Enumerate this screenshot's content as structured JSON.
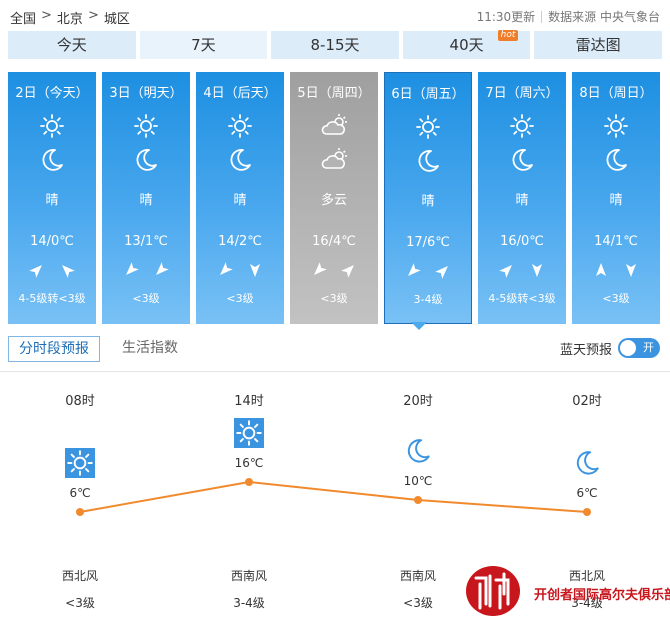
{
  "breadcrumb": {
    "level1": "全国",
    "level2": "北京",
    "level3": "城区",
    "separator": ">"
  },
  "meta": {
    "updated": "11:30更新",
    "source": "数据来源 中央气象台"
  },
  "tabs": [
    {
      "label": "今天"
    },
    {
      "label": "7天"
    },
    {
      "label": "8-15天"
    },
    {
      "label": "40天",
      "badge": "hot"
    },
    {
      "label": "雷达图"
    }
  ],
  "days": [
    {
      "title": "2日（今天）",
      "day_icon": "sun-icon",
      "night_icon": "moon-icon",
      "desc": "晴",
      "temp": "14/0℃",
      "wind_day": "arrow-northeast",
      "wind_night": "arrow-northwest",
      "level": "4-5级转<3级"
    },
    {
      "title": "3日（明天）",
      "day_icon": "sun-icon",
      "night_icon": "moon-icon",
      "desc": "晴",
      "temp": "13/1℃",
      "wind_day": "arrow-southwest",
      "wind_night": "arrow-southwest",
      "level": "<3级"
    },
    {
      "title": "4日（后天）",
      "day_icon": "sun-icon",
      "night_icon": "moon-icon",
      "desc": "晴",
      "temp": "14/2℃",
      "wind_day": "arrow-southwest",
      "wind_night": "arrow-south",
      "level": "<3级"
    },
    {
      "title": "5日（周四）",
      "day_icon": "partly-cloudy-icon",
      "night_icon": "partly-cloudy-icon",
      "desc": "多云",
      "temp": "16/4℃",
      "wind_day": "arrow-southwest",
      "wind_night": "arrow-northeast",
      "level": "<3级"
    },
    {
      "title": "6日（周五）",
      "day_icon": "sun-icon",
      "night_icon": "moon-icon",
      "desc": "晴",
      "temp": "17/6℃",
      "wind_day": "arrow-southwest",
      "wind_night": "arrow-northeast",
      "level": "3-4级"
    },
    {
      "title": "7日（周六）",
      "day_icon": "sun-icon",
      "night_icon": "moon-icon",
      "desc": "晴",
      "temp": "16/0℃",
      "wind_day": "arrow-northeast",
      "wind_night": "arrow-south",
      "level": "4-5级转<3级"
    },
    {
      "title": "8日（周日）",
      "day_icon": "sun-icon",
      "night_icon": "moon-icon",
      "desc": "晴",
      "temp": "14/1℃",
      "wind_day": "arrow-north",
      "wind_night": "arrow-south",
      "level": "<3级"
    }
  ],
  "subtabs": {
    "hourly": "分时段预报",
    "life": "生活指数"
  },
  "toggle": {
    "label": "蓝天预报",
    "state": "开"
  },
  "hourly": [
    {
      "time": "08时",
      "icon": "sun-icon",
      "temp": "6℃",
      "temp_value": 6,
      "wind": "西北风",
      "level": "<3级"
    },
    {
      "time": "14时",
      "icon": "sun-icon",
      "temp": "16℃",
      "temp_value": 16,
      "wind": "西南风",
      "level": "3-4级"
    },
    {
      "time": "20时",
      "icon": "moon-icon",
      "temp": "10℃",
      "temp_value": 10,
      "wind": "西南风",
      "level": "<3级"
    },
    {
      "time": "02时",
      "icon": "moon-icon",
      "temp": "6℃",
      "temp_value": 6,
      "wind": "西北风",
      "level": "3-4级"
    }
  ],
  "colors": {
    "line": "#f08a2c",
    "day_sunny_top": "#1d8fe1",
    "day_cloudy": "#a8a8a8",
    "icon_blue": "#3b94df",
    "watermark_red": "#c8161d"
  },
  "watermark": {
    "text": "开创者国际高尔夫俱乐部"
  }
}
